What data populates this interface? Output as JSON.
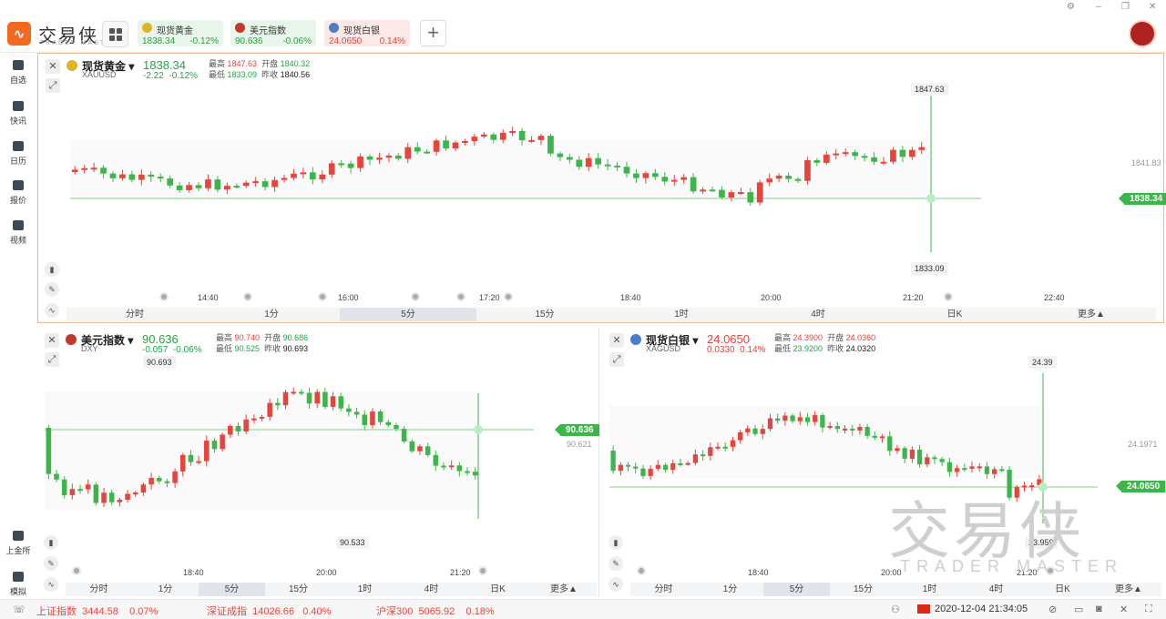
{
  "app": {
    "brand": "交易侠",
    "brand_sub": "TRADER MASTER",
    "logo_glyph": "∿"
  },
  "tabs": [
    {
      "name": "现货黄金",
      "price": "1838.34",
      "change": "-0.12%",
      "dir": "down",
      "bg": "#e8f5ea",
      "icon_color": "#e0b422"
    },
    {
      "name": "美元指数",
      "price": "90.636",
      "change": "-0.06%",
      "dir": "down",
      "bg": "#e8f5ea",
      "icon_color": "#c0392b"
    },
    {
      "name": "现货白银",
      "price": "24.0650",
      "change": "0.14%",
      "dir": "up",
      "bg": "#fbe9e8",
      "icon_color": "#4a7ecc"
    }
  ],
  "window_controls": {
    "settings": "⚙",
    "minimize": "–",
    "restore": "❐",
    "close": "✕"
  },
  "sidebar": [
    {
      "label": "自选",
      "icon": "bookmark-icon"
    },
    {
      "label": "快讯",
      "icon": "news-icon"
    },
    {
      "label": "日历",
      "icon": "calendar-icon"
    },
    {
      "label": "报价",
      "icon": "quote-icon"
    },
    {
      "label": "视频",
      "icon": "video-icon"
    }
  ],
  "sidebar_bottom": [
    {
      "label": "上金所",
      "icon": "exchange-icon"
    },
    {
      "label": "模拟",
      "icon": "simulate-icon"
    }
  ],
  "timeframes": [
    "分时",
    "1分",
    "5分",
    "15分",
    "1时",
    "4时",
    "日K",
    "更多▲"
  ],
  "panels": {
    "gold": {
      "name": "现货黄金",
      "code": "XAUUSD",
      "price": "1838.34",
      "chg": "-2.22",
      "chgp": "-0.12%",
      "high_label": "最高",
      "high": "1847.63",
      "open_label": "开盘",
      "open": "1840.32",
      "low_label": "最低",
      "low": "1833.09",
      "prev_label": "昨收",
      "prev": "1840.56",
      "ymax_label": "1847.63",
      "ymin_label": "1833.09",
      "ref_price": "1841.83",
      "times": [
        "14:40",
        "16:00",
        "17:20",
        "18:40",
        "20:00",
        "21:20",
        "22:40"
      ]
    },
    "dxy": {
      "name": "美元指数",
      "code": "DXY",
      "price": "90.636",
      "chg": "-0.057",
      "chgp": "-0.06%",
      "high_label": "最高",
      "high": "90.740",
      "open_label": "开盘",
      "open": "90.686",
      "low_label": "最低",
      "low": "90.525",
      "prev_label": "昨收",
      "prev": "90.693",
      "ymax_label": "90.693",
      "ymin_label": "90.533",
      "ref_price": "90.621",
      "times": [
        "18:40",
        "20:00",
        "21:20"
      ]
    },
    "silver": {
      "name": "现货白银",
      "code": "XAGUSD",
      "price": "24.0650",
      "chg": "0.0330",
      "chgp": "0.14%",
      "high_label": "最高",
      "high": "24.3900",
      "open_label": "开盘",
      "open": "24.0360",
      "low_label": "最低",
      "low": "23.9200",
      "prev_label": "昨收",
      "prev": "24.0320",
      "ymax_label": "24.39",
      "ymin_label": "23.959",
      "ref_price": "24.1971",
      "times": [
        "18:40",
        "20:00",
        "21:20"
      ]
    }
  },
  "watermark": {
    "cn": "交易侠",
    "en": "TRADER MASTER"
  },
  "bottombar": {
    "indices": [
      {
        "name": "上证指数",
        "value": "3444.58",
        "pct": "0.07%"
      },
      {
        "name": "深证成指",
        "value": "14026.66",
        "pct": "0.40%"
      },
      {
        "name": "沪深300",
        "value": "5065.92",
        "pct": "0.18%"
      }
    ],
    "datetime": "2020-12-04 21:34:05"
  }
}
